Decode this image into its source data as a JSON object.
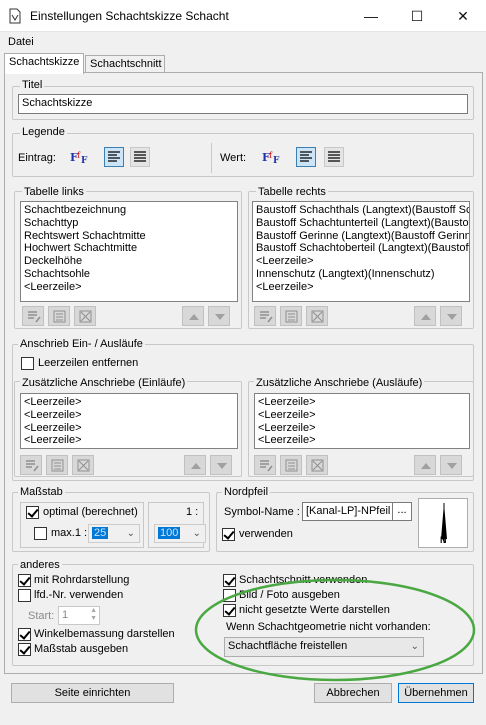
{
  "window": {
    "title": "Einstellungen Schachtskizze Schacht",
    "minimize": "—",
    "maximize": "☐",
    "close": "✕"
  },
  "menu": {
    "datei": "Datei"
  },
  "tabs": [
    {
      "label": "Schachtskizze",
      "active": true
    },
    {
      "label": "Schachtschnitt",
      "active": false
    }
  ],
  "titel": {
    "legend": "Titel",
    "value": "Schachtskizze"
  },
  "legende": {
    "legend": "Legende",
    "eintrag_label": "Eintrag:",
    "wert_label": "Wert:"
  },
  "tabelle_links": {
    "legend": "Tabelle links",
    "items": [
      "Schachtbezeichnung",
      "Schachttyp",
      "Rechtswert Schachtmitte",
      "Hochwert Schachtmitte",
      "Deckelhöhe",
      "Schachtsohle",
      "<Leerzeile>"
    ]
  },
  "tabelle_rechts": {
    "legend": "Tabelle rechts",
    "items": [
      "Baustoff Schachthals (Langtext)(Baustoff Schachthals)",
      "Baustoff Schachtunterteil (Langtext)(Baustoff Schachtunterteil)",
      "Baustoff Gerinne (Langtext)(Baustoff Gerinne)",
      "Baustoff Schachtoberteil (Langtext)(Baustoff Schachtoberteil)",
      "<Leerzeile>",
      "Innenschutz (Langtext)(Innenschutz)",
      "<Leerzeile>"
    ]
  },
  "anschrieb": {
    "legend": "Anschrieb Ein- / Ausläufe",
    "leerzeilen_label": "Leerzeilen entfernen",
    "einlaeufe": {
      "legend": "Zusätzliche Anschriebe (Einläufe)",
      "items": [
        "<Leerzeile>",
        "<Leerzeile>",
        "<Leerzeile>",
        "<Leerzeile>"
      ]
    },
    "auslaeufe": {
      "legend": "Zusätzliche Anschriebe (Ausläufe)",
      "items": [
        "<Leerzeile>",
        "<Leerzeile>",
        "<Leerzeile>",
        "<Leerzeile>"
      ]
    }
  },
  "massstab": {
    "legend": "Maßstab",
    "optimal_label": "optimal (berechnet)",
    "max_label": "max.1 :",
    "max_value": "25",
    "ratio_label": "1 :",
    "ratio_value": "100"
  },
  "nordpfeil": {
    "legend": "Nordpfeil",
    "symbol_label": "Symbol-Name :",
    "symbol_value": "[Kanal-LP]-NPfeil",
    "browse": "...",
    "verwenden_label": "verwenden",
    "preview_letter": "N"
  },
  "anderes": {
    "legend": "anderes",
    "rohr_label": "mit Rohrdarstellung",
    "lfd_label": "lfd.-Nr. verwenden",
    "start_label": "Start:",
    "start_value": "1",
    "winkel_label": "Winkelbemassung darstellen",
    "massstab_label": "Maßstab ausgeben",
    "schnitt_label": "Schachtschnitt verwenden",
    "bild_label": "Bild / Foto ausgeben",
    "nicht_label": "nicht gesetzte Werte darstellen",
    "geometrie_label": "Wenn Schachtgeometrie nicht vorhanden:",
    "geometrie_value": "Schachtfläche freistellen"
  },
  "footer": {
    "seite": "Seite einrichten",
    "abbrechen": "Abbrechen",
    "uebernehmen": "Übernehmen"
  },
  "colors": {
    "highlight_ellipse": "#4aa842",
    "selection": "#0078d7"
  }
}
